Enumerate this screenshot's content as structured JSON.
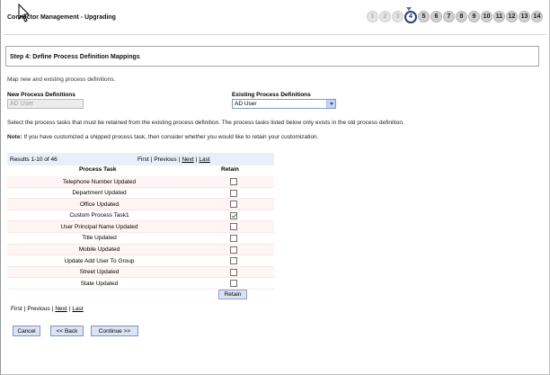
{
  "app": {
    "title": "Connector Management - Upgrading"
  },
  "steps": {
    "items": [
      "1",
      "2",
      "3",
      "4",
      "5",
      "6",
      "7",
      "8",
      "9",
      "10",
      "11",
      "12",
      "13",
      "14"
    ],
    "current": 4
  },
  "step_box": {
    "title": "Step 4: Define Process Definition Mappings"
  },
  "intro": "Map new and existing process definitions.",
  "new_defs": {
    "label": "New Process Definitions",
    "value": "AD User"
  },
  "existing_defs": {
    "label": "Existing Process Definitions",
    "selected": "AD User"
  },
  "para1": "Select the process tasks that must be retained from the existing process definition. The process tasks listed below only exists in the old process definition.",
  "note": {
    "label": "Note:",
    "text": " If you have customized a shipped process task, then consider whether you would like to retain your customization."
  },
  "results": {
    "count_text": "Results 1-10 of 46",
    "pager": {
      "first": "First",
      "previous": "Previous",
      "next": "Next",
      "last": "Last"
    },
    "columns": {
      "task": "Process Task",
      "retain": "Retain"
    },
    "rows": [
      {
        "task": "Telephone Number Updated",
        "retain": false
      },
      {
        "task": "Department Updated",
        "retain": false
      },
      {
        "task": "Office Updated",
        "retain": false
      },
      {
        "task": "Custom Process Task1",
        "retain": true
      },
      {
        "task": "User Principal Name Updated",
        "retain": false
      },
      {
        "task": "Title Updated",
        "retain": false
      },
      {
        "task": "Mobile Updated",
        "retain": false
      },
      {
        "task": "Update Add User To Group",
        "retain": false
      },
      {
        "task": "Street Updated",
        "retain": false
      },
      {
        "task": "State Updated",
        "retain": false
      }
    ],
    "retain_button": "Retain"
  },
  "buttons": {
    "cancel": "Cancel",
    "back": "<< Back",
    "continue": "Continue >>"
  },
  "colors": {
    "accent": "#2b3f78",
    "row_tint": "#fff5f5",
    "header_tint": "#e9eef8",
    "button_bg": "#dbe3f4"
  }
}
